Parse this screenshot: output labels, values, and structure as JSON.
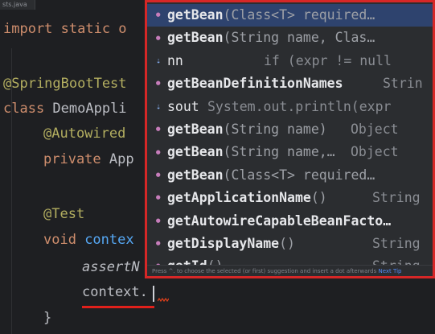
{
  "editor": {
    "tab_label": "sts.java",
    "code": {
      "import_kw": "import static o",
      "annotation_springboottest": "@SpringBootTest",
      "class_kw": "class",
      "class_name": " DemoAppli",
      "annotation_autowired": "@Autowired",
      "private_kw": "private",
      "private_type": " App",
      "annotation_test": "@Test",
      "void_kw": "void",
      "method_name": " contex",
      "assert_call": "assertN",
      "context_expr": "context.",
      "closing_brace": "}"
    }
  },
  "completion_popup": {
    "items": [
      {
        "name": "getBean",
        "params": "(Class<T> required…",
        "right": "",
        "selected": true
      },
      {
        "name": "getBean",
        "params": "(String name, Clas…",
        "right": "",
        "selected": false
      },
      {
        "name": "nn",
        "params": "",
        "right": "if (expr != null",
        "selected": false,
        "live": true
      },
      {
        "name": "getBeanDefinitionNames",
        "params": "",
        "right": "Strin",
        "selected": false
      },
      {
        "name": "sout",
        "params": "",
        "right": "System.out.println(expr",
        "selected": false,
        "live": true
      },
      {
        "name": "getBean",
        "params": "(String name)",
        "right": "Object",
        "selected": false
      },
      {
        "name": "getBean",
        "params": "(String name,…",
        "right": "Object",
        "selected": false
      },
      {
        "name": "getBean",
        "params": "(Class<T> required…",
        "right": "",
        "selected": false
      },
      {
        "name": "getApplicationName",
        "params": "()",
        "right": "String",
        "selected": false
      },
      {
        "name": "getAutowireCapableBeanFacto…",
        "params": "",
        "right": "",
        "selected": false
      },
      {
        "name": "getDisplayName",
        "params": "()",
        "right": "String",
        "selected": false
      },
      {
        "name": "getId",
        "params": "()",
        "right": "String",
        "selected": false
      }
    ],
    "footer_text": "Press ^. to choose the selected (or first) suggestion and insert a dot afterwards",
    "footer_link": "Next Tip"
  },
  "colors": {
    "highlight_border": "#d62727",
    "selected_row": "#2e436e",
    "keyword": "#cf8e6d",
    "annotation": "#b3ae60"
  }
}
